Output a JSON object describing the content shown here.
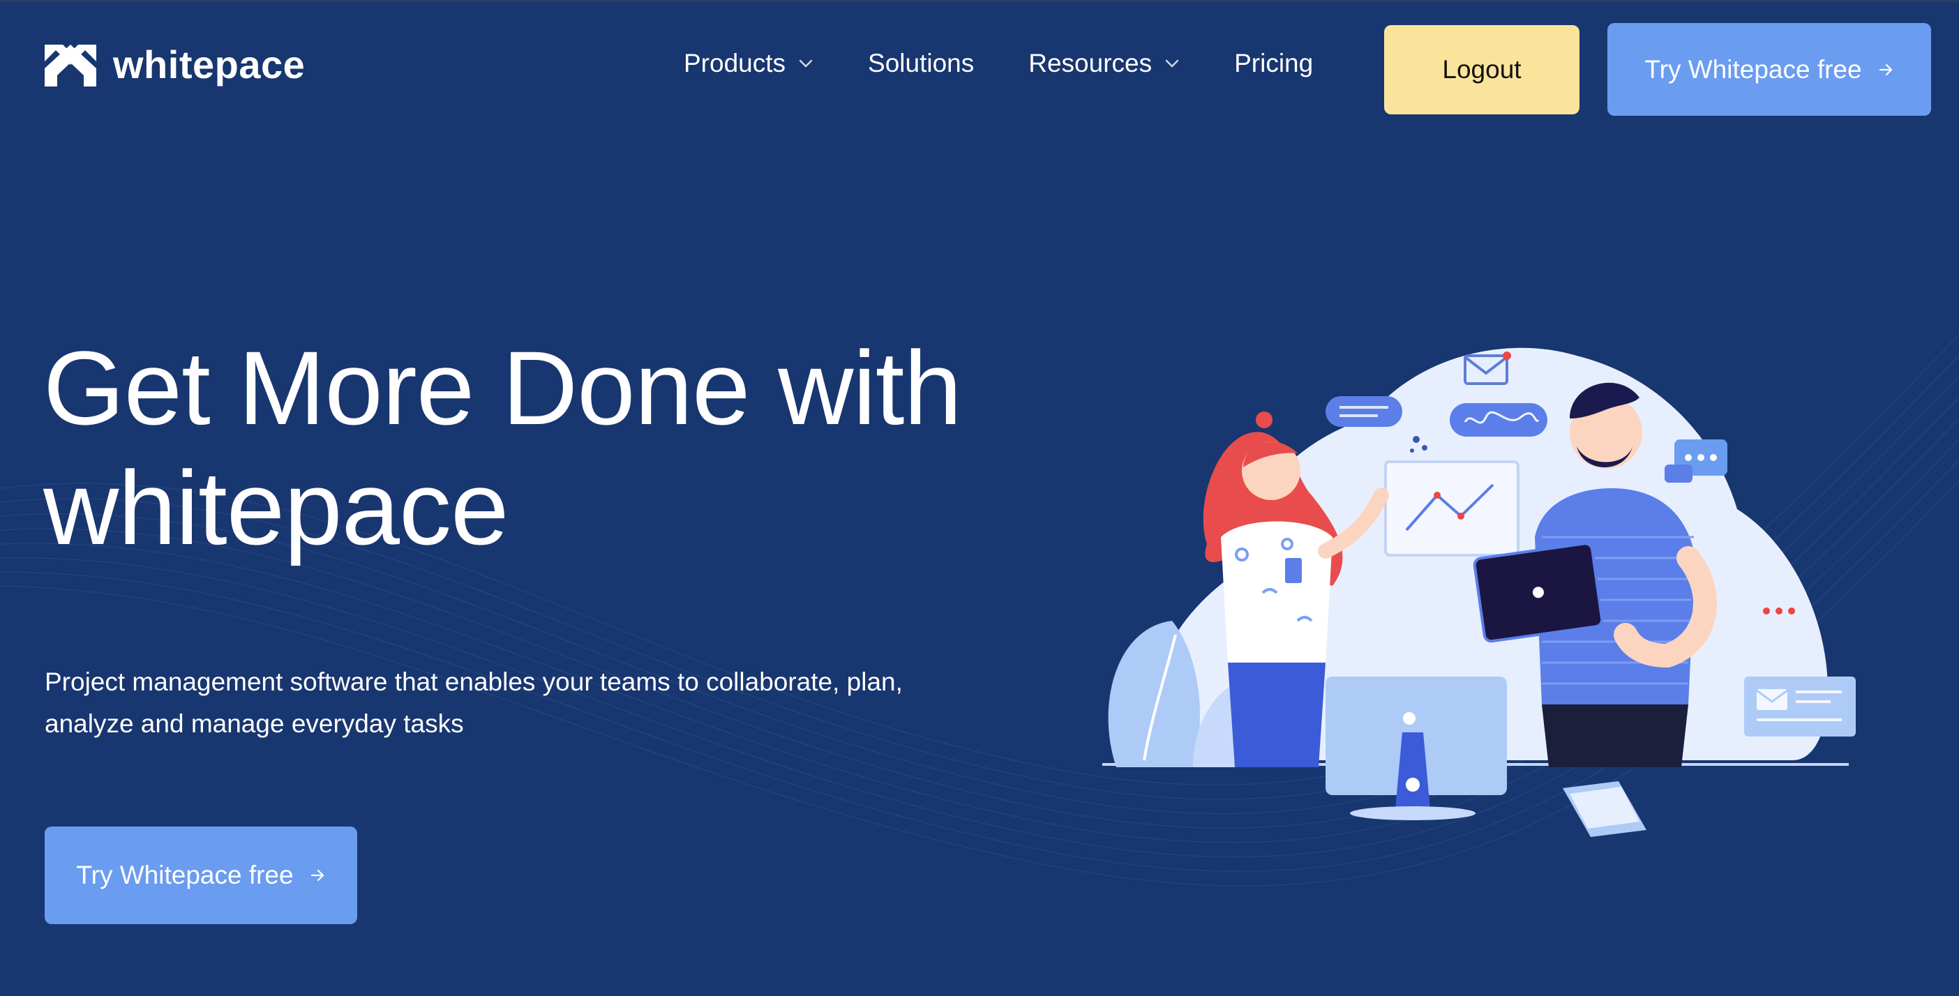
{
  "brand": {
    "name": "whitepace"
  },
  "nav": {
    "items": [
      {
        "label": "Products",
        "has_dropdown": true
      },
      {
        "label": "Solutions",
        "has_dropdown": false
      },
      {
        "label": "Resources",
        "has_dropdown": true
      },
      {
        "label": "Pricing",
        "has_dropdown": false
      }
    ],
    "logout_label": "Logout",
    "cta_label": "Try Whitepace free"
  },
  "hero": {
    "title_line1": "Get More Done with",
    "title_line2": "whitepace",
    "subtitle_line1": "Project management software that enables your teams to collaborate, plan,",
    "subtitle_line2": "analyze and manage everyday tasks",
    "cta_label": "Try Whitepace free"
  },
  "colors": {
    "background": "#18366f",
    "logout_button": "#fae49b",
    "primary_button": "#6a9cf0",
    "illustration_blob": "#e7efff"
  },
  "icons": {
    "logo": "whitepace-logo-icon",
    "dropdown": "chevron-down-icon",
    "cta_arrow": "arrow-right-icon"
  }
}
